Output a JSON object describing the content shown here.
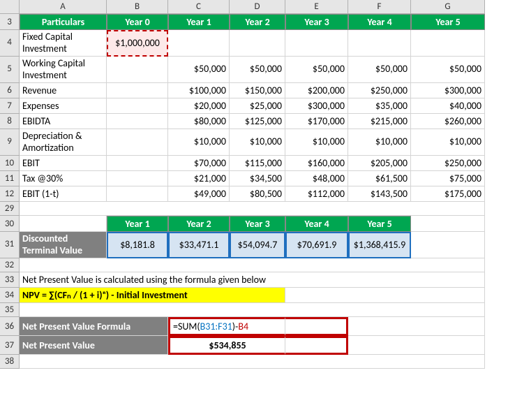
{
  "columns": [
    "",
    "A",
    "B",
    "C",
    "D",
    "E",
    "F",
    "G"
  ],
  "rows": [
    "3",
    "4",
    "5",
    "6",
    "7",
    "8",
    "9",
    "10",
    "11",
    "12",
    "29",
    "30",
    "31",
    "32",
    "33",
    "34",
    "35",
    "36",
    "37",
    "38"
  ],
  "header": {
    "particulars": "Particulars",
    "y0": "Year 0",
    "y1": "Year 1",
    "y2": "Year 2",
    "y3": "Year 3",
    "y4": "Year 4",
    "y5": "Year 5"
  },
  "labels": {
    "fixed": "Fixed Capital Investment",
    "working": "Working Capital Investment",
    "revenue": "Revenue",
    "expenses": "Expenses",
    "ebidta": "EBIDTA",
    "da": "Depreciation & Amortization",
    "ebit": "EBIT",
    "tax": "Tax @30%",
    "ebit1t": "EBIT (1-t)"
  },
  "fixed_capital": "$1,000,000",
  "working_capital": {
    "y1": "$50,000",
    "y2": "$50,000",
    "y3": "$50,000",
    "y4": "$50,000",
    "y5": "$50,000"
  },
  "revenue": {
    "y1": "$100,000",
    "y2": "$150,000",
    "y3": "$200,000",
    "y4": "$250,000",
    "y5": "$300,000"
  },
  "expenses": {
    "y1": "$20,000",
    "y2": "$25,000",
    "y3": "$300,000",
    "y4": "$35,000",
    "y5": "$40,000"
  },
  "ebidta": {
    "y1": "$80,000",
    "y2": "$125,000",
    "y3": "$170,000",
    "y4": "$215,000",
    "y5": "$260,000"
  },
  "da": {
    "y1": "$10,000",
    "y2": "$10,000",
    "y3": "$10,000",
    "y4": "$10,000",
    "y5": "$10,000"
  },
  "ebit": {
    "y1": "$70,000",
    "y2": "$115,000",
    "y3": "$160,000",
    "y4": "$205,000",
    "y5": "$250,000"
  },
  "tax": {
    "y1": "$21,000",
    "y2": "$34,500",
    "y3": "$48,000",
    "y4": "$61,500",
    "y5": "$75,000"
  },
  "ebit1t": {
    "y1": "$49,000",
    "y2": "$80,500",
    "y3": "$112,000",
    "y4": "$143,500",
    "y5": "$175,000"
  },
  "sec2": {
    "y1": "Year 1",
    "y2": "Year 2",
    "y3": "Year 3",
    "y4": "Year 4",
    "y5": "Year 5",
    "dtv_label": "Discounted Terminal Value",
    "dtv": {
      "y1": "$8,181.8",
      "y2": "$33,471.1",
      "y3": "$54,094.7",
      "y4": "$70,691.9",
      "y5": "$1,368,415.9"
    }
  },
  "desc": "Net Present Value is calculated using the formula given below",
  "npv_formula_text": "NPV = ∑(CFₙ / (1 + i)ⁿ) - Initial Investment",
  "npv": {
    "formula_label": "Net Present Value Formula",
    "value_label": "Net Present Value",
    "formula_prefix": "=SUM(",
    "formula_range": "B31:F31",
    "formula_mid": ")-",
    "formula_ref": "B4",
    "value": "$534,855"
  }
}
